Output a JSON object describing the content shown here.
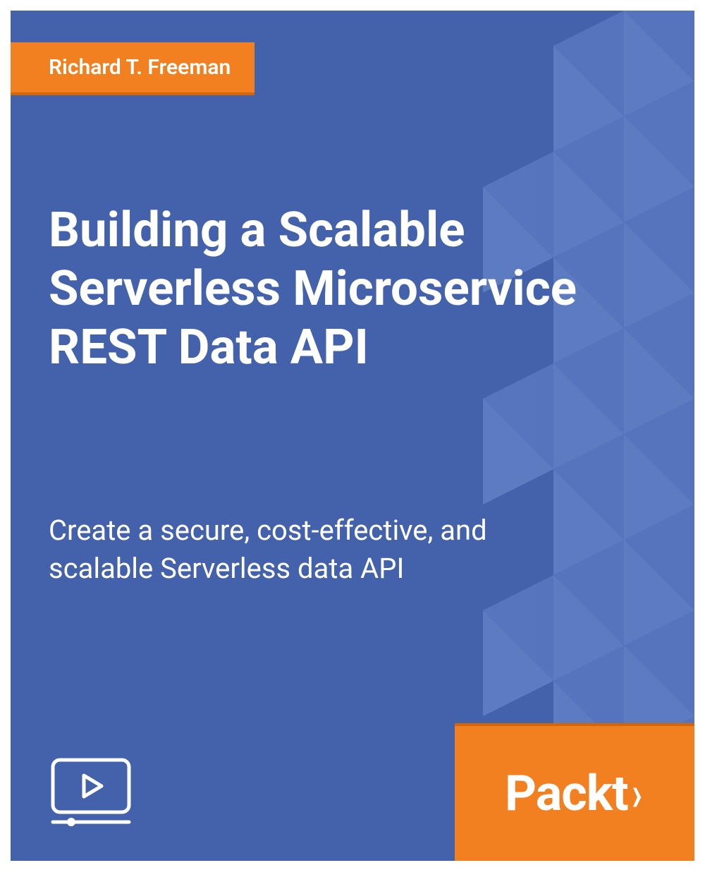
{
  "author": "Richard T. Freeman",
  "title": "Building a Scalable Serverless Microservice REST Data API",
  "subtitle": "Create a secure, cost-effective, and scalable Serverless data API",
  "publisher": "Packt",
  "publisher_angle": "›",
  "colors": {
    "background": "#4462ac",
    "accent": "#f38020",
    "accent_shadow": "#d86500",
    "pattern_light": "#5a78c1",
    "pattern_lighter": "#7290d3"
  }
}
